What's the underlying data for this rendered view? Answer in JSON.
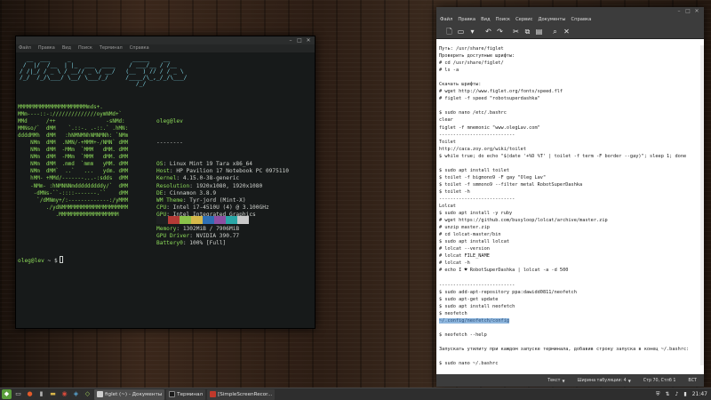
{
  "terminal": {
    "menu": [
      "Файл",
      "Правка",
      "Вид",
      "Поиск",
      "Терминал",
      "Справка"
    ],
    "figlet": "  __  ___     _                  _____    __\n /  |/  /__  | |_  ___  ____    / ___/__ / /__\n/ /|_/ / _ \\ / __// _ \\/ __/   (__  ) // / / _ \\\n/_/  /_/\\___/ \\__/ \\___/_/     /____/\\_,_/_/\\___/\n                                  /_/",
    "logo": "MMMMMMMMMMMMMMMMMMMMMMmds+.\nMMm----::-://////////////oymNMd+`\nMMd      /++                -sNMd:\nMMNso/`  dMM    `.::-. .-::.` .hMN:\nddddMMh  dMM   :hNMNMNhNMNMNh: `NMm\n    NMm  dMM  .NMN/-+MMM+-/NMN` dMM\n    NMm  dMM  -MMm  `MMM   dMM. dMM\n    NMm  dMM  -MMm  `MMM   dMM. dMM\n    NMm  dMM  .mmd  `mmm   yMM. dMM\n    NMm  dMM`  ..`   ...   ydm. dMM\n    hMM- +MMd/-------...-:sdds  dMM\n    -NMm- :hNMNNNmdddddddddy/`  dMM\n     -dMNs-``-::::-------.``    dMM\n      `/dMNmy+/:-------------:/yMMM\n         ./ydNMMMMMMMMMMMMMMMMMMMMM\n            .MMMMMMMMMMMMMMMMMMM",
    "user": "oleg@lev",
    "separator": "--------",
    "info": [
      {
        "key": "OS",
        "value": "Linux Mint 19 Tara x86_64"
      },
      {
        "key": "Host",
        "value": "HP Pavilion 17 Notebook PC 0975110"
      },
      {
        "key": "Kernel",
        "value": "4.15.0-38-generic"
      },
      {
        "key": "Resolution",
        "value": "1920x1080, 1920x1080"
      },
      {
        "key": "DE",
        "value": "Cinnamon 3.8.9"
      },
      {
        "key": "WM Theme",
        "value": "Tyr-jord (Mint-X)"
      },
      {
        "key": "CPU",
        "value": "Intel i7-4510U (4) @ 3.100GHz"
      },
      {
        "key": "GPU",
        "value": "Intel Integrated Graphics"
      },
      {
        "key": "GPU",
        "value": "NVIDIA GeForce 840M"
      },
      {
        "key": "Memory",
        "value": "1302MiB / 7906MiB"
      },
      {
        "key": "GPU Driver",
        "value": "NVIDIA 390.77"
      },
      {
        "key": "Battery0",
        "value": "100% [Full]"
      }
    ],
    "palette": [
      "#1d1f21",
      "#b53b36",
      "#8bc34a",
      "#d6b94a",
      "#2f6fb3",
      "#8e4fa3",
      "#2aa6a6",
      "#c9c9c9"
    ],
    "prompt_user": "oleg@lev",
    "prompt_path": "~",
    "prompt_symbol": "$"
  },
  "editor": {
    "menu": [
      "Файл",
      "Правка",
      "Вид",
      "Поиск",
      "Сервис",
      "Документы",
      "Справка"
    ],
    "text_before": "Путь: /usr/share/figlet\nПроверить доступные шрифты:\n# cd /usr/share/figlet/\n# ls -a\n\nСкачать шрифты:\n# wget http://www.figlet.org/fonts/speed.flf\n# figlet -f speed \"robotsuperdashka\"\n\n$ sudo nano /etc/.bashrc\nclear\nfiglet -f mnemonic \"www.olegLav.com\"\n---------------------------\nToilet\nhttp://caca.zoy.org/wiki/toilet\n$ while true; do echo \"$(date '+%D %T' | toilet -f term -F border --gay)\"; sleep 1; done\n\n$ sudo apt install toilet\n$ toilet -f bigmono9 -F gay \"Oleg Lav\"\n$ toilet -f smmono9 --filter metal RobotSuperDashka\n$ toilet -h\n---------------------------\nLolcat\n$ sudo apt install -y ruby\n# wget https://github.com/busyloop/lolcat/archive/master.zip\n# unzip master.zip\n# cd lolcat-master/bin\n$ sudo apt install lolcat\n# lolcat --version\n# lolcat FILE_NAME\n# lolcat -h\n# echo I ♥ RobotSuperDashka | lolcat -a -d 500\n\n---------------------------\n$ sudo add-apt-repository ppa:dawidd0811/neofetch\n$ sudo apt-get update\n$ sudo apt install neofetch\n$ neofetch\n",
    "highlight": "~/.config/neofetch/config",
    "text_after": "\n\n$ neofetch --help\n\nЗапускать утилиту при каждом запуске терминала, добавив строку запуска в конец ~/.bashrc:\n\n$ sudo nano ~/.bashrc\n\n...\nneofetch",
    "status": {
      "mode": "Текст",
      "tab_width": "Ширина табуляции: 4",
      "position": "Стр 70, Стлб 1",
      "insert": "ВСТ"
    }
  },
  "taskbar": {
    "tasks": [
      {
        "label": "figlet (~) - Документы",
        "color": "#cfcfcf"
      },
      {
        "label": "Терминал",
        "color": "#2b2b2b"
      },
      {
        "label": "[SimpleScreenRecor...",
        "color": "#c0392b"
      }
    ],
    "clock": "21:47"
  }
}
